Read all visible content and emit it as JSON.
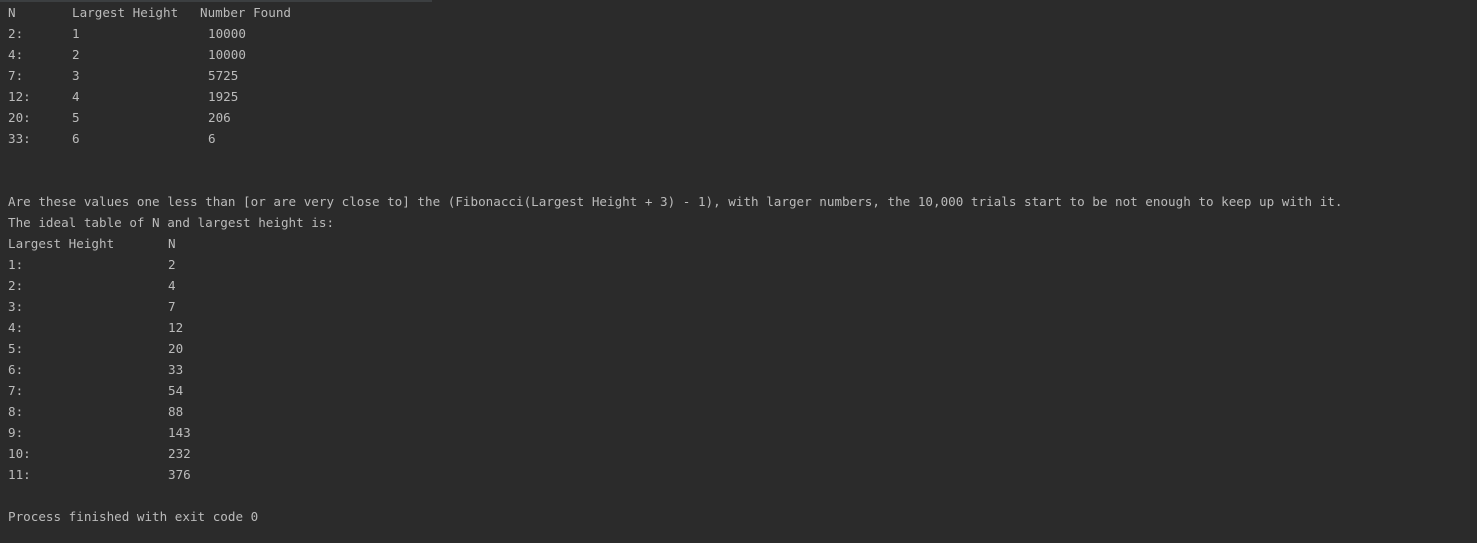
{
  "table1": {
    "headers": [
      "N",
      "Largest Height",
      "Number Found"
    ],
    "rows": [
      [
        "2:",
        "1",
        "10000"
      ],
      [
        "4:",
        "2",
        "10000"
      ],
      [
        "7:",
        "3",
        "5725"
      ],
      [
        "12:",
        "4",
        "1925"
      ],
      [
        "20:",
        "5",
        "206"
      ],
      [
        "33:",
        "6",
        "6"
      ]
    ]
  },
  "note_line": "Are these values one less than [or are very close to] the (Fibonacci(Largest Height + 3) - 1), with larger numbers, the 10,000 trials start to be not enough to keep up with it.",
  "ideal_intro": "The ideal table of N and largest height is:",
  "table2": {
    "headers": [
      "Largest Height",
      "N"
    ],
    "rows": [
      [
        "1:",
        "2"
      ],
      [
        "2:",
        "4"
      ],
      [
        "3:",
        "7"
      ],
      [
        "4:",
        "12"
      ],
      [
        "5:",
        "20"
      ],
      [
        "6:",
        "33"
      ],
      [
        "7:",
        "54"
      ],
      [
        "8:",
        "88"
      ],
      [
        "9:",
        "143"
      ],
      [
        "10:",
        "232"
      ],
      [
        "11:",
        "376"
      ]
    ]
  },
  "exit_message": "Process finished with exit code 0"
}
